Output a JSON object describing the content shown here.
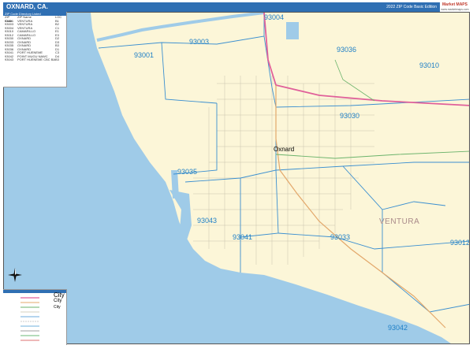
{
  "header": {
    "title": "OXNARD, CA.",
    "edition": "2022 ZIP Code Basic Edition",
    "brand_main": "Market MAPS",
    "brand_sub": "www.marketmaps.com"
  },
  "legend": {
    "heading": "ZIP Code Directory Listed",
    "columns": [
      "ZIP Code",
      "ZIP Name",
      "LOC"
    ],
    "rows": [
      {
        "zip": "93001",
        "name": "VENTURA",
        "loc": "B1"
      },
      {
        "zip": "93003",
        "name": "VENTURA",
        "loc": "B2"
      },
      {
        "zip": "93004",
        "name": "VENTURA",
        "loc": "C1"
      },
      {
        "zip": "93010",
        "name": "CAMARILLO",
        "loc": "E1"
      },
      {
        "zip": "93012",
        "name": "CAMARILLO",
        "loc": "E3"
      },
      {
        "zip": "93030",
        "name": "OXNARD",
        "loc": "D2"
      },
      {
        "zip": "93033",
        "name": "OXNARD",
        "loc": "D3"
      },
      {
        "zip": "93035",
        "name": "OXNARD",
        "loc": "B3"
      },
      {
        "zip": "93036",
        "name": "OXNARD",
        "loc": "D1"
      },
      {
        "zip": "93041",
        "name": "PORT HUENEME",
        "loc": "C3"
      },
      {
        "zip": "93042",
        "name": "POINT MUGU NAWC",
        "loc": "D4"
      },
      {
        "zip": "93043",
        "name": "PORT HUENEME CBC BASE",
        "loc": "B3"
      }
    ]
  },
  "key": {
    "city_large": "City",
    "city_medium": "City",
    "city_small": "City"
  },
  "map": {
    "water_color": "#9fcbe8",
    "land_color": "#fcf6d8",
    "zip_color": "#1e7fc6",
    "highway_color": "#e0609a",
    "city": "Oxnard",
    "county": "VENTURA",
    "zip_labels": [
      "93004",
      "93003",
      "93001",
      "93036",
      "93010",
      "93030",
      "93035",
      "93043",
      "93041",
      "93033",
      "93012",
      "93042"
    ]
  }
}
